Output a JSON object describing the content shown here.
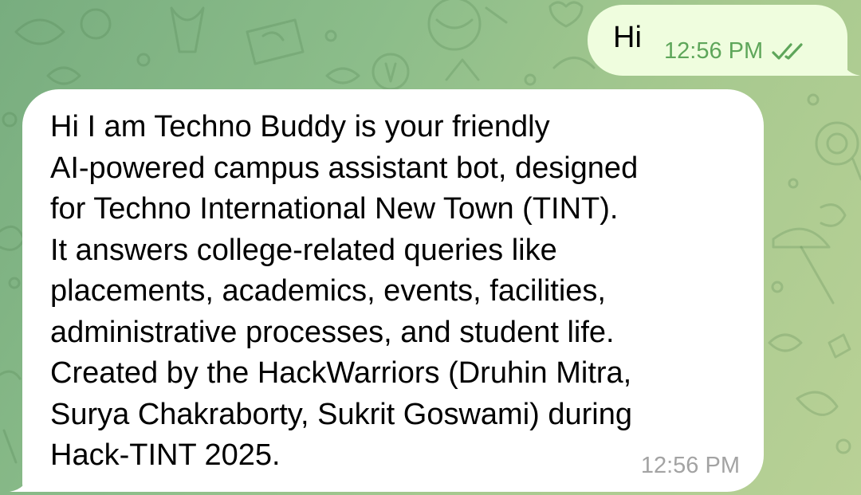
{
  "chat": {
    "outgoing": {
      "text": "Hi",
      "time": "12:56 PM",
      "status_icon": "double-check-icon",
      "bubble_color": "#effdde",
      "time_color": "#5ea65a"
    },
    "incoming": {
      "text": "Hi I am Techno Buddy is your friendly\nAI-powered campus assistant bot, designed\nfor Techno International New Town (TINT).\nIt answers college-related queries like\nplacements, academics, events, facilities,\nadministrative processes, and student life.\nCreated by the HackWarriors (Druhin Mitra,\nSurya Chakraborty, Sukrit Goswami) during\nHack-TINT 2025.",
      "time": "12:56 PM",
      "bubble_color": "#ffffff",
      "time_color": "#a3a3a3"
    }
  },
  "theme": {
    "wallpaper_colors": [
      "#78ad7f",
      "#b9d196"
    ]
  }
}
